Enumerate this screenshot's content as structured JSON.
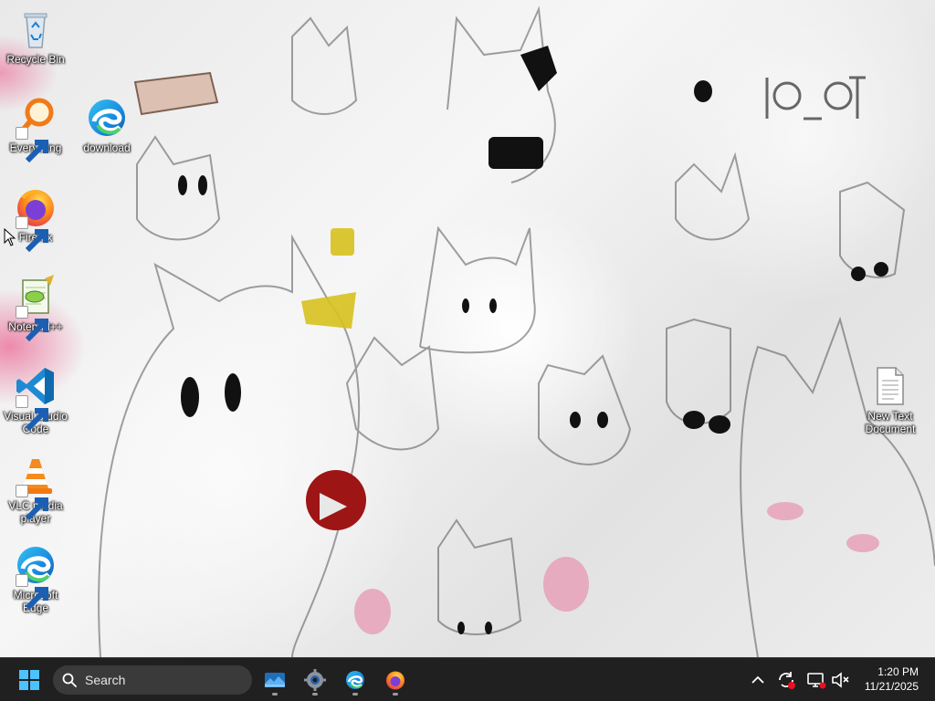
{
  "desktop": {
    "icons": [
      {
        "label": "Recycle Bin",
        "icon": "recycle-bin-icon"
      },
      {
        "label": "Everything",
        "icon": "everything-search-icon"
      },
      {
        "label": "download",
        "icon": "edge-icon"
      },
      {
        "label": "Firefox",
        "icon": "firefox-icon"
      },
      {
        "label": "Notepad++",
        "icon": "notepad-plus-plus-icon"
      },
      {
        "label": "Visual Studio Code",
        "icon": "vscode-icon"
      },
      {
        "label": "VLC media player",
        "icon": "vlc-icon"
      },
      {
        "label": "Microsoft Edge",
        "icon": "edge-icon"
      },
      {
        "label": "New Text Document",
        "icon": "text-document-icon"
      }
    ]
  },
  "taskbar": {
    "search_label": "Search",
    "apps": [
      "task-view",
      "settings",
      "edge",
      "firefox"
    ],
    "tray": {
      "time": "1:20 PM",
      "date": "11/21/2025"
    }
  },
  "colors": {
    "taskbar_bg": "#202020",
    "search_bg": "#3a3a3a",
    "accent": "#0078d4"
  }
}
